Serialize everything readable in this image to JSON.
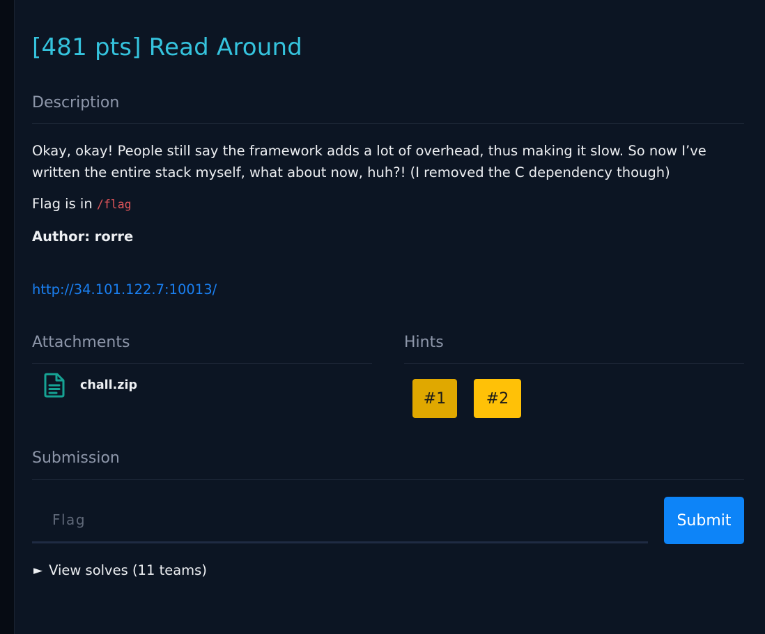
{
  "challenge": {
    "title": "[481 pts] Read Around"
  },
  "description": {
    "heading": "Description",
    "text": "Okay, okay! People still say the framework adds a lot of overhead, thus making it slow. So now I’ve written the entire stack myself, what about now, huh?! (I removed the C dependency though)",
    "flag_prefix": "Flag is in ",
    "flag_path": "/flag",
    "author": "Author: rorre",
    "url": "http://34.101.122.7:10013/"
  },
  "attachments": {
    "heading": "Attachments",
    "items": [
      {
        "name": "chall.zip",
        "icon": "file-document-icon"
      }
    ]
  },
  "hints": {
    "heading": "Hints",
    "items": [
      {
        "label": "#1",
        "color": "#e0a800"
      },
      {
        "label": "#2",
        "color": "#ffc107"
      }
    ]
  },
  "submission": {
    "heading": "Submission",
    "placeholder": "Flag",
    "submit_label": "Submit"
  },
  "solves": {
    "arrow": "►",
    "label": "View solves (11 teams)"
  },
  "colors": {
    "background": "#0c1523",
    "title": "#35c3dd",
    "link": "#1a7ff0",
    "code": "#e0555a",
    "primary": "#0d84f8",
    "icon": "#16a394"
  }
}
